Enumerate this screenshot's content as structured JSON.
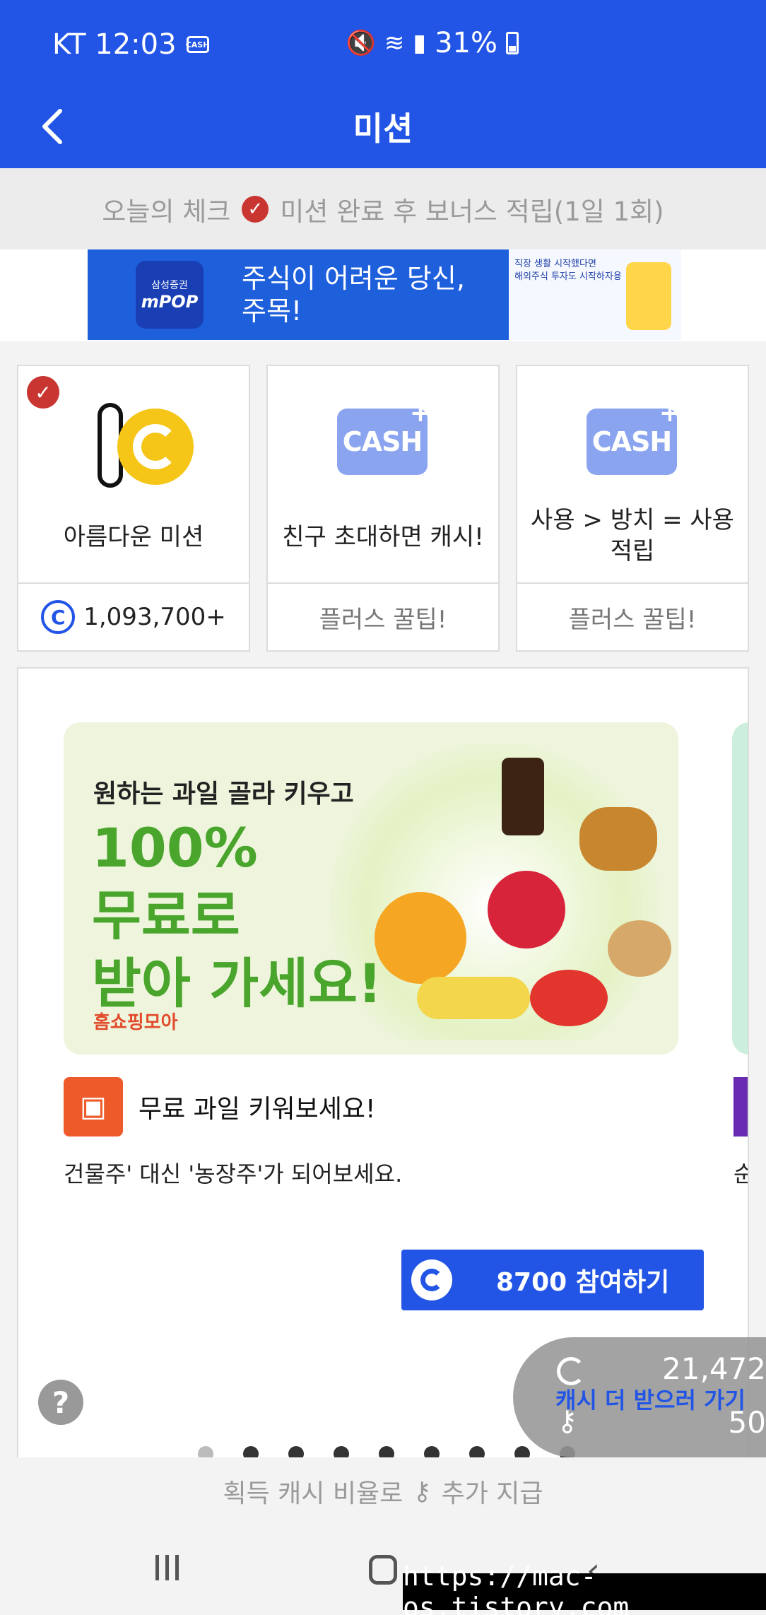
{
  "status": {
    "carrier_time": "KT 12:03",
    "cash_icon": "CASH",
    "battery": "31%"
  },
  "header": {
    "title": "미션",
    "back_icon": "chevron-left-icon"
  },
  "daily_check": {
    "prefix": "오늘의 체크",
    "suffix": "미션 완료 후 보너스 적립(1일 1회)"
  },
  "ad": {
    "logo_top": "삼성증권",
    "logo_main": "mPOP",
    "line1": "주식이 어려운 당신,",
    "line2": "주목!",
    "right_line1": "직장 생활 시작했다면",
    "right_line2": "해외주식 투자도 시작하자용"
  },
  "cards": [
    {
      "title": "아름다운 미션",
      "footer": "1,093,700+",
      "done": true
    },
    {
      "title": "친구 초대하면 캐시!",
      "footer": "플러스 꿀팁!",
      "badge": "CASH"
    },
    {
      "title": "사용 > 방치 = 사용 적립",
      "footer": "플러스 꿀팁!",
      "badge": "CASH"
    }
  ],
  "offer": {
    "promo_head": "원하는 과일 골라 키우고",
    "promo_big1": "100%",
    "promo_big2": "무료로",
    "promo_big3": "받아 가세요!",
    "promo_brand": "홈쇼핑모아",
    "title": "무료 과일 키워보세요!",
    "desc": "건물주' 대신 '농장주'가 되어보세요.",
    "desc_peek": "순",
    "button": "8700 참여하기"
  },
  "floating": {
    "cash": "21,472",
    "keys": "50",
    "link": "캐시 더 받으러 가기"
  },
  "help": "?",
  "bonus": {
    "left": "획득 캐시 비율로",
    "right": "추가 지급"
  },
  "watermark": "https://mac-os.tistory.com",
  "pagination": {
    "total": 9,
    "current": 1
  }
}
